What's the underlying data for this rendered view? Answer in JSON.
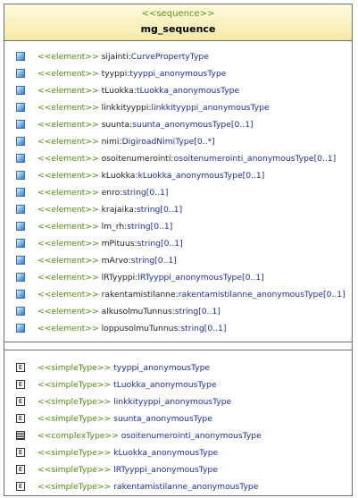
{
  "header": {
    "stereotype": "<<sequence>>",
    "title": "mg_sequence"
  },
  "elements": [
    {
      "stereotype": "<<element>>",
      "name": "sijainti",
      "type": "CurvePropertyType",
      "mult": ""
    },
    {
      "stereotype": "<<element>>",
      "name": "tyyppi",
      "type": "tyyppi_anonymousType",
      "mult": ""
    },
    {
      "stereotype": "<<element>>",
      "name": "tLuokka",
      "type": "tLuokka_anonymousType",
      "mult": ""
    },
    {
      "stereotype": "<<element>>",
      "name": "linkkityyppi",
      "type": "linkkityyppi_anonymousType",
      "mult": ""
    },
    {
      "stereotype": "<<element>>",
      "name": "suunta",
      "type": "suunta_anonymousType",
      "mult": "[0..1]"
    },
    {
      "stereotype": "<<element>>",
      "name": "nimi",
      "type": "DigiroadNimiType",
      "mult": "[0..*]"
    },
    {
      "stereotype": "<<element>>",
      "name": "osoitenumerointi",
      "type": "osoitenumerointi_anonymousType",
      "mult": "[0..1]"
    },
    {
      "stereotype": "<<element>>",
      "name": "kLuokka",
      "type": "kLuokka_anonymousType",
      "mult": "[0..1]"
    },
    {
      "stereotype": "<<element>>",
      "name": "enro",
      "type": "string",
      "mult": "[0..1]"
    },
    {
      "stereotype": "<<element>>",
      "name": "krajaika",
      "type": "string",
      "mult": "[0..1]"
    },
    {
      "stereotype": "<<element>>",
      "name": "lm_rh",
      "type": "string",
      "mult": "[0..1]"
    },
    {
      "stereotype": "<<element>>",
      "name": "mPituus",
      "type": "string",
      "mult": "[0..1]"
    },
    {
      "stereotype": "<<element>>",
      "name": "mArvo",
      "type": "string",
      "mult": "[0..1]"
    },
    {
      "stereotype": "<<element>>",
      "name": "lRTyyppi",
      "type": "lRTyyppi_anonymousType",
      "mult": "[0..1]"
    },
    {
      "stereotype": "<<element>>",
      "name": "rakentamistilanne",
      "type": "rakentamistilanne_anonymousType",
      "mult": "[0..1]"
    },
    {
      "stereotype": "<<element>>",
      "name": "alkusolmuTunnus",
      "type": "string",
      "mult": "[0..1]"
    },
    {
      "stereotype": "<<element>>",
      "name": "loppusolmuTunnus",
      "type": "string",
      "mult": "[0..1]"
    }
  ],
  "types": [
    {
      "kind": "simple",
      "icon_glyph": "E",
      "stereotype": "<<simpleType>>",
      "name": "tyyppi_anonymousType"
    },
    {
      "kind": "simple",
      "icon_glyph": "E",
      "stereotype": "<<simpleType>>",
      "name": "tLuokka_anonymousType"
    },
    {
      "kind": "simple",
      "icon_glyph": "E",
      "stereotype": "<<simpleType>>",
      "name": "linkkityyppi_anonymousType"
    },
    {
      "kind": "simple",
      "icon_glyph": "E",
      "stereotype": "<<simpleType>>",
      "name": "suunta_anonymousType"
    },
    {
      "kind": "complex",
      "icon_glyph": "",
      "stereotype": "<<complexType>>",
      "name": "osoitenumerointi_anonymousType"
    },
    {
      "kind": "simple",
      "icon_glyph": "E",
      "stereotype": "<<simpleType>>",
      "name": "kLuokka_anonymousType"
    },
    {
      "kind": "simple",
      "icon_glyph": "E",
      "stereotype": "<<simpleType>>",
      "name": "lRTyyppi_anonymousType"
    },
    {
      "kind": "simple",
      "icon_glyph": "E",
      "stereotype": "<<simpleType>>",
      "name": "rakentamistilanne_anonymousType"
    }
  ],
  "colors": {
    "stereotype": "#4f8a10",
    "type_name": "#1d2e9c",
    "header_top": "#fffbdf",
    "header_bottom": "#f6e9a6"
  }
}
